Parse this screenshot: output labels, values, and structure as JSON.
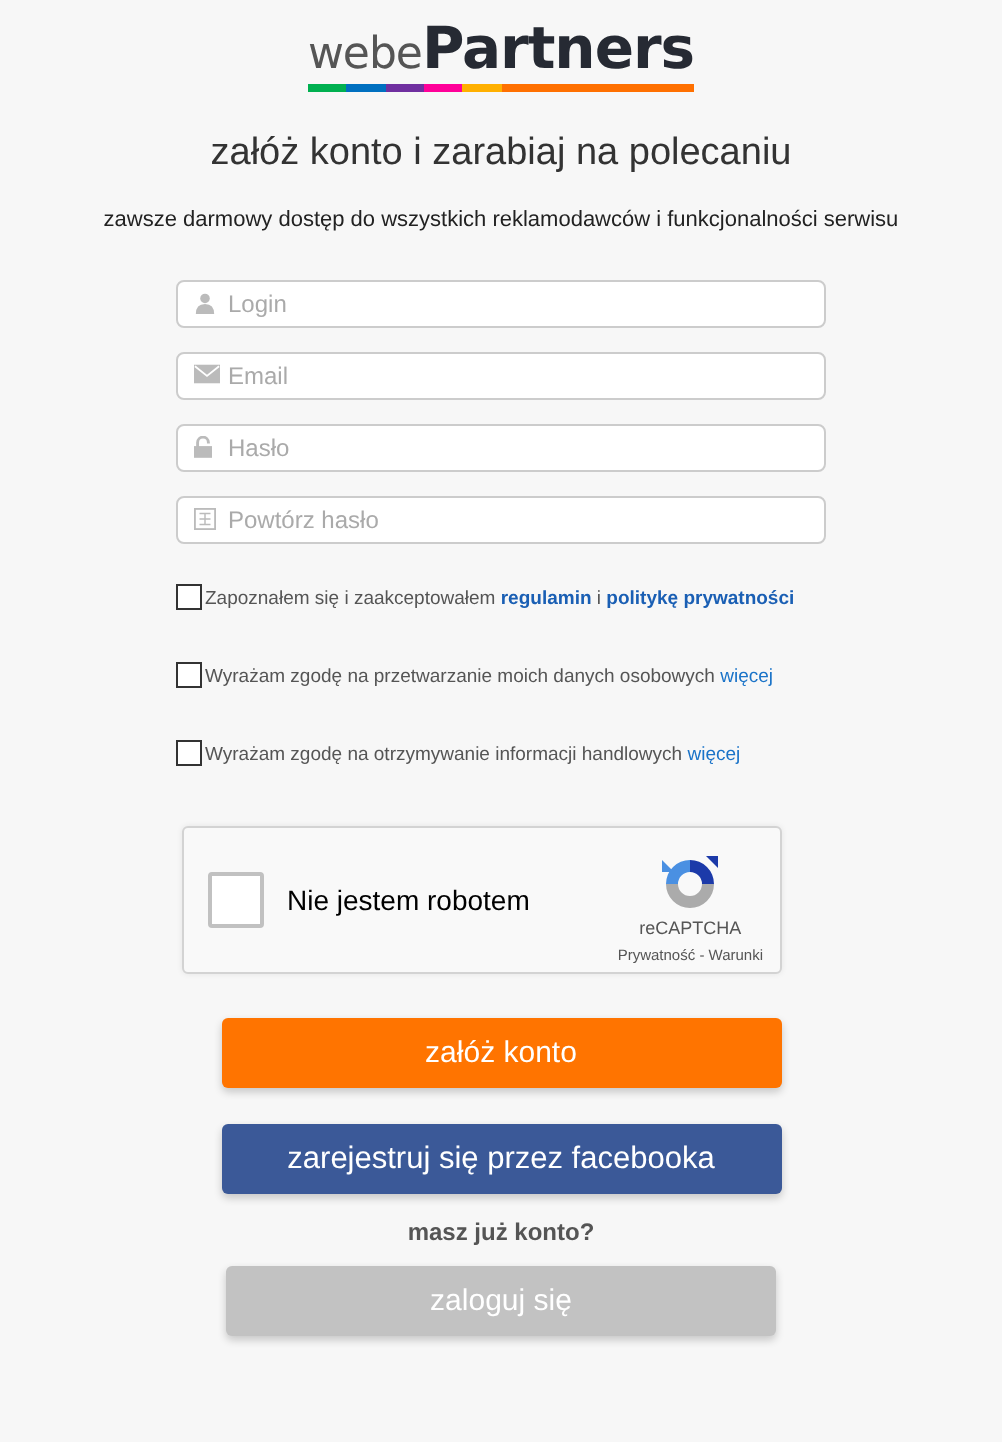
{
  "logo": {
    "prefix": "webe",
    "name": "Partners"
  },
  "heading": "załóż konto i zarabiaj na polecaniu",
  "subheading": "zawsze darmowy dostęp do wszystkich reklamodawców i funkcjonalności serwisu",
  "fields": [
    {
      "kind": "user",
      "placeholder": "Login"
    },
    {
      "kind": "mail",
      "placeholder": "Email"
    },
    {
      "kind": "lock",
      "placeholder": "Hasło"
    },
    {
      "kind": "grid",
      "placeholder": "Powtórz hasło"
    }
  ],
  "consents": [
    {
      "checked": false,
      "parts": [
        {
          "kind": "text",
          "text": "Zapoznałem się i zaakceptowałem "
        },
        {
          "kind": "link",
          "text": "regulamin",
          "bold": true
        },
        {
          "kind": "text",
          "text": " i "
        },
        {
          "kind": "link",
          "text": "politykę prywatności",
          "bold": true
        }
      ]
    },
    {
      "checked": false,
      "parts": [
        {
          "kind": "text",
          "text": "Wyrażam zgodę na przetwarzanie moich danych osobowych "
        },
        {
          "kind": "link",
          "text": "więcej",
          "bold": false
        }
      ]
    },
    {
      "checked": false,
      "parts": [
        {
          "kind": "text",
          "text": "Wyrażam zgodę na otrzymywanie informacji handlowych "
        },
        {
          "kind": "link",
          "text": "więcej",
          "bold": false
        }
      ]
    }
  ],
  "captcha": {
    "checked": false,
    "label": "Nie jestem robotem",
    "brand": "reCAPTCHA",
    "links": "Prywatność - Warunki"
  },
  "register_button": "załóż konto",
  "facebook_button": "zarejestruj się przez facebooka",
  "have_account": "masz już konto?",
  "login_button": "zaloguj się"
}
